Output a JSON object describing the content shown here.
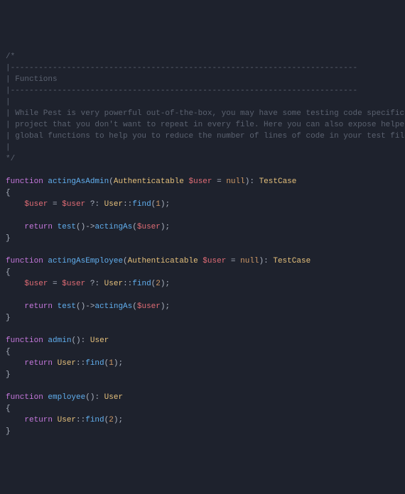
{
  "comment": {
    "open": "/*",
    "bar": "|--------------------------------------------------------------------------",
    "title": "| Functions",
    "pipe": "|",
    "l1": "| While Pest is very powerful out-of-the-box, you may have some testing code specific to your",
    "l2": "| project that you don't want to repeat in every file. Here you can also expose helpers as",
    "l3": "| global functions to help you to reduce the number of lines of code in your test files.",
    "close": "*/"
  },
  "kw": {
    "function": "function",
    "return": "return",
    "null": "null"
  },
  "fn": {
    "actingAsAdmin": "actingAsAdmin",
    "actingAsEmployee": "actingAsEmployee",
    "admin": "admin",
    "employee": "employee",
    "find": "find",
    "test": "test",
    "actingAs": "actingAs"
  },
  "type": {
    "Authenticatable": "Authenticatable",
    "TestCase": "TestCase",
    "User": "User"
  },
  "var": {
    "user": "$user"
  },
  "num": {
    "one": "1",
    "two": "2"
  },
  "p": {
    "lparen": "(",
    "rparen": ")",
    "lbrace": "{",
    "rbrace": "}",
    "colon": ":",
    "dcolon": "::",
    "semi": ";",
    "arrow": "->",
    "eq": " = ",
    "ternary": " ?: ",
    "space": " ",
    "sp4": "    "
  }
}
